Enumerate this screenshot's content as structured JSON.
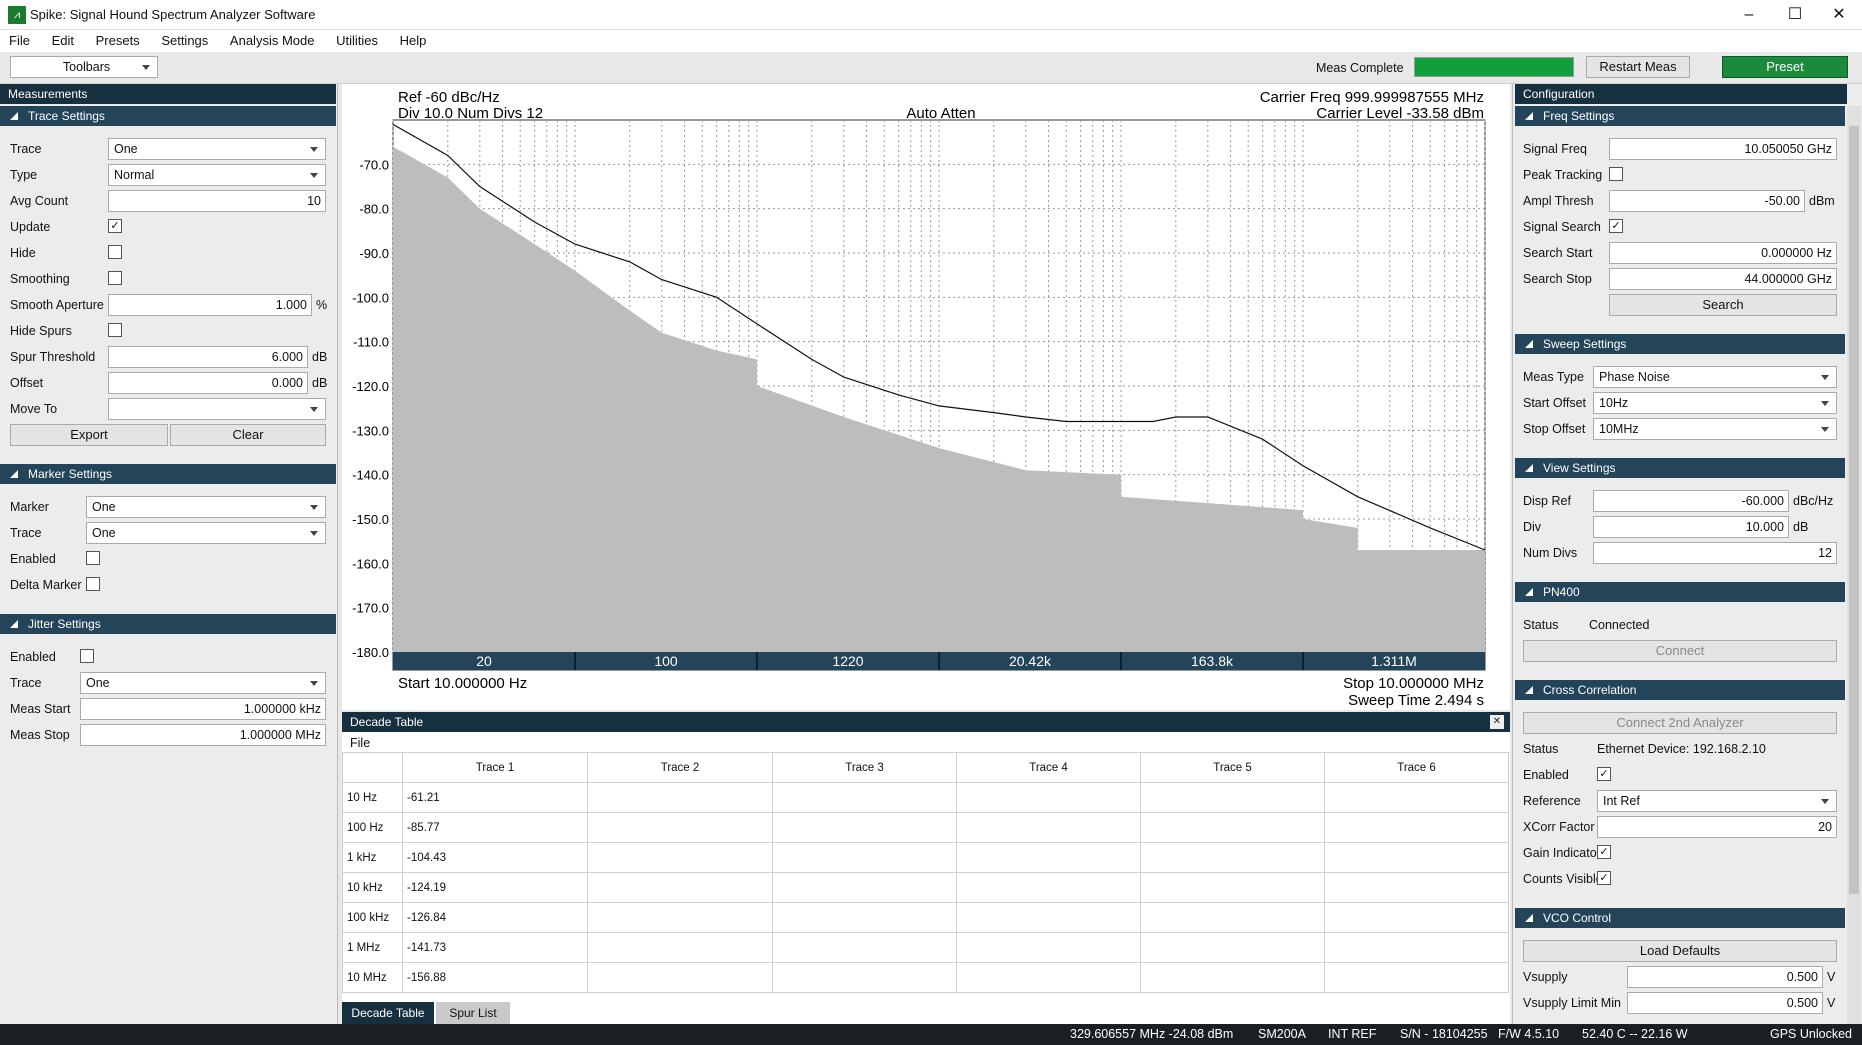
{
  "app": {
    "title": "Spike: Signal Hound Spectrum Analyzer Software",
    "icon": "signal-hound-icon"
  },
  "menu": [
    "File",
    "Edit",
    "Presets",
    "Settings",
    "Analysis Mode",
    "Utilities",
    "Help"
  ],
  "toolbar": {
    "toolbars_label": "Toolbars",
    "meas_status": "Meas Complete",
    "meas_progress": 1.0,
    "restart_label": "Restart Meas",
    "preset_label": "Preset",
    "accent": "#1b8a3c",
    "progress_color": "#0fa03c"
  },
  "left": {
    "panel_title": "Measurements",
    "trace_settings": {
      "title": "Trace Settings",
      "trace_label": "Trace",
      "trace_value": "One",
      "type_label": "Type",
      "type_value": "Normal",
      "avg_label": "Avg Count",
      "avg_value": "10",
      "update_label": "Update",
      "update_checked": true,
      "hide_label": "Hide",
      "smoothing_label": "Smoothing",
      "aperture_label": "Smooth Aperture",
      "aperture_value": "1.000",
      "aperture_unit": "%",
      "hidespurs_label": "Hide Spurs",
      "spur_label": "Spur Threshold",
      "spur_value": "6.000",
      "spur_unit": "dB",
      "offset_label": "Offset",
      "offset_value": "0.000",
      "offset_unit": "dB",
      "moveto_label": "Move To",
      "moveto_value": "",
      "export_label": "Export",
      "clear_label": "Clear"
    },
    "marker_settings": {
      "title": "Marker Settings",
      "marker_label": "Marker",
      "marker_value": "One",
      "trace_label": "Trace",
      "trace_value": "One",
      "enabled_label": "Enabled",
      "delta_label": "Delta Marker"
    },
    "jitter_settings": {
      "title": "Jitter Settings",
      "enabled_label": "Enabled",
      "trace_label": "Trace",
      "trace_value": "One",
      "start_label": "Meas Start",
      "start_value": "1.000000 kHz",
      "stop_label": "Meas Stop",
      "stop_value": "1.000000 MHz"
    }
  },
  "chart": {
    "ref": "Ref -60 dBc/Hz",
    "div": "Div 10.0 Num Divs 12",
    "atten": "Auto Atten",
    "carrier_freq": "Carrier Freq 999.999987555 MHz",
    "carrier_level": "Carrier Level -33.58 dBm",
    "start": "Start 10.000000 Hz",
    "stop": "Stop 10.000000 MHz",
    "sweep": "Sweep Time 2.494 s",
    "y_ticks": [
      "-70.0",
      "-80.0",
      "-90.0",
      "-100.0",
      "-110.0",
      "-120.0",
      "-130.0",
      "-140.0",
      "-150.0",
      "-160.0",
      "-170.0",
      "-180.0"
    ],
    "x_ticks": [
      "20",
      "100",
      "1220",
      "20.42k",
      "163.8k",
      "1.311M"
    ]
  },
  "chart_data": {
    "type": "line",
    "xscale": "log",
    "xlim": [
      10,
      10000000
    ],
    "ylim": [
      -180,
      -60
    ],
    "grid": true,
    "series": [
      {
        "x": [
          10,
          20,
          30,
          60,
          100,
          200,
          300,
          600,
          1000,
          2000,
          3000,
          6000,
          10000,
          20000,
          30000,
          50000,
          100000,
          150000,
          200000,
          300000,
          600000,
          1000000,
          2000000,
          5000000,
          10000000
        ],
        "values": [
          -61,
          -68,
          -75,
          -83,
          -88,
          -92,
          -96,
          -100,
          -106,
          -114,
          -118,
          -122,
          -124.5,
          -126,
          -127,
          -128,
          -128,
          -128,
          -127,
          -127,
          -132,
          -138,
          -145,
          -152,
          -157
        ]
      },
      {
        "x": [
          10,
          20,
          30,
          60,
          100,
          200,
          300,
          600,
          1000,
          1001,
          3000,
          10000,
          30000,
          100000,
          100001,
          1000000,
          1000001,
          2000000,
          2000001,
          10000000
        ],
        "values": [
          -66,
          -73,
          -80,
          -88,
          -94,
          -103,
          -108,
          -112,
          -114,
          -120,
          -127,
          -134,
          -139,
          -140,
          -145,
          -148,
          -150,
          -152,
          -157,
          -157
        ]
      }
    ]
  },
  "decade": {
    "title": "Decade Table",
    "close_icon": "close-icon",
    "file_menu": "File",
    "headers": [
      "Trace 1",
      "Trace 2",
      "Trace 3",
      "Trace 4",
      "Trace 5",
      "Trace 6"
    ],
    "rows": [
      {
        "f": "10 Hz",
        "v": "-61.21"
      },
      {
        "f": "100 Hz",
        "v": "-85.77"
      },
      {
        "f": "1 kHz",
        "v": "-104.43"
      },
      {
        "f": "10 kHz",
        "v": "-124.19"
      },
      {
        "f": "100 kHz",
        "v": "-126.84"
      },
      {
        "f": "1 MHz",
        "v": "-141.73"
      },
      {
        "f": "10 MHz",
        "v": "-156.88"
      }
    ],
    "tabs": [
      "Decade Table",
      "Spur List"
    ]
  },
  "right": {
    "panel_title": "Configuration",
    "freq": {
      "title": "Freq Settings",
      "signal_label": "Signal Freq",
      "signal_value": "10.050050 GHz",
      "peak_label": "Peak Tracking",
      "ampl_label": "Ampl Thresh",
      "ampl_value": "-50.00",
      "ampl_unit": "dBm",
      "search_label": "Signal Search",
      "sstart_label": "Search Start",
      "sstart_value": "0.000000 Hz",
      "sstop_label": "Search Stop",
      "sstop_value": "44.000000 GHz",
      "search_btn": "Search"
    },
    "sweep": {
      "title": "Sweep Settings",
      "meas_label": "Meas Type",
      "meas_value": "Phase Noise",
      "start_label": "Start Offset",
      "start_value": "10Hz",
      "stop_label": "Stop Offset",
      "stop_value": "10MHz"
    },
    "view": {
      "title": "View Settings",
      "ref_label": "Disp Ref",
      "ref_value": "-60.000",
      "ref_unit": "dBc/Hz",
      "div_label": "Div",
      "div_value": "10.000",
      "div_unit": "dB",
      "nd_label": "Num Divs",
      "nd_value": "12"
    },
    "pn400": {
      "title": "PN400",
      "status_label": "Status",
      "status_value": "Connected",
      "connect_btn": "Connect"
    },
    "xcorr": {
      "title": "Cross Correlation",
      "connect_btn": "Connect 2nd Analyzer",
      "status_label": "Status",
      "status_value": "Ethernet Device:  192.168.2.10",
      "enabled_label": "Enabled",
      "ref_label": "Reference",
      "ref_value": "Int Ref",
      "factor_label": "XCorr Factor",
      "factor_value": "20",
      "gain_label": "Gain Indicator",
      "counts_label": "Counts Visible"
    },
    "vco": {
      "title": "VCO Control",
      "load_btn": "Load Defaults",
      "vs_label": "Vsupply",
      "vs_value": "0.500",
      "vs_unit": "V",
      "vsmin_label": "Vsupply Limit Min",
      "vsmin_value": "0.500",
      "vsmin_unit": "V"
    }
  },
  "status": {
    "marker": "329.606557 MHz  -24.08 dBm",
    "device": "SM200A",
    "ref": "INT REF",
    "sn": "S/N - 18104255",
    "fw": "F/W 4.5.10",
    "temp": "52.40 C -- 22.16 W",
    "gps": "GPS Unlocked"
  }
}
